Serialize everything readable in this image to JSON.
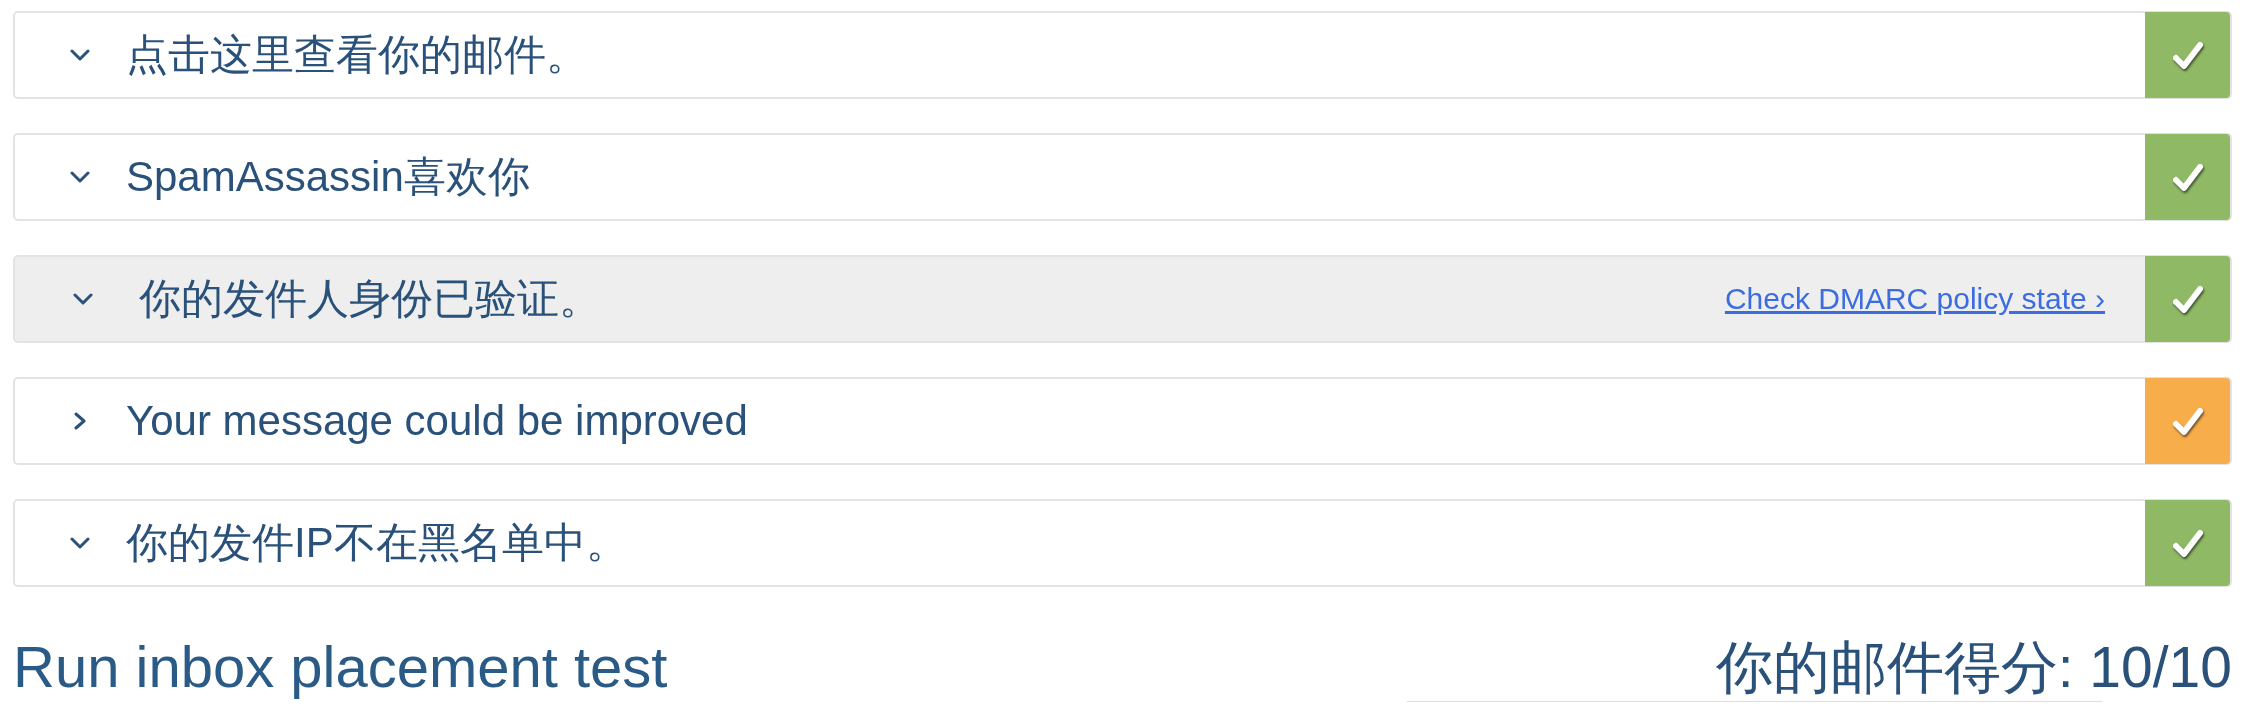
{
  "checks": [
    {
      "title": "点击这里查看你的邮件。",
      "expanded": true,
      "highlighted": false,
      "color": "#8fb965"
    },
    {
      "title": "SpamAssassin喜欢你",
      "expanded": true,
      "highlighted": false,
      "color": "#8fb965"
    },
    {
      "title": "你的发件人身份已验证。",
      "expanded": true,
      "highlighted": true,
      "link": "Check DMARC policy state ›",
      "color": "#8fb965"
    },
    {
      "title": "Your message could be improved",
      "expanded": false,
      "highlighted": false,
      "color": "#f8ad4b"
    },
    {
      "title": "你的发件IP不在黑名单中。",
      "expanded": true,
      "highlighted": false,
      "color": "#8fb965"
    }
  ],
  "footer": {
    "placement_test": "Run inbox placement test",
    "score": "你的邮件得分: 10/10"
  }
}
